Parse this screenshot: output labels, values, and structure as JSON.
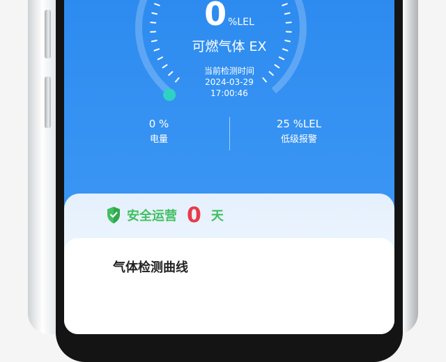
{
  "gauge": {
    "reading_value": "0",
    "reading_unit": "%LEL",
    "gas_name": "可燃气体 EX",
    "time_label": "当前检测时间",
    "date": "2024-03-29",
    "time": "17:00:46",
    "level_fraction": 0
  },
  "stats": {
    "battery_value": "0 %",
    "battery_label": "电量",
    "alarm_value": "25 %LEL",
    "alarm_label": "低级报警"
  },
  "safety": {
    "label": "安全运营",
    "days": "0",
    "unit": "天"
  },
  "chart_section": {
    "title": "气体检测曲线"
  },
  "colors": {
    "header_blue": "#2d8bf0",
    "gauge_dot": "#2fd1c3",
    "safe_green": "#3fbf5f",
    "days_red": "#e93a4a"
  },
  "icons": {
    "shield": "shield-check-icon"
  }
}
